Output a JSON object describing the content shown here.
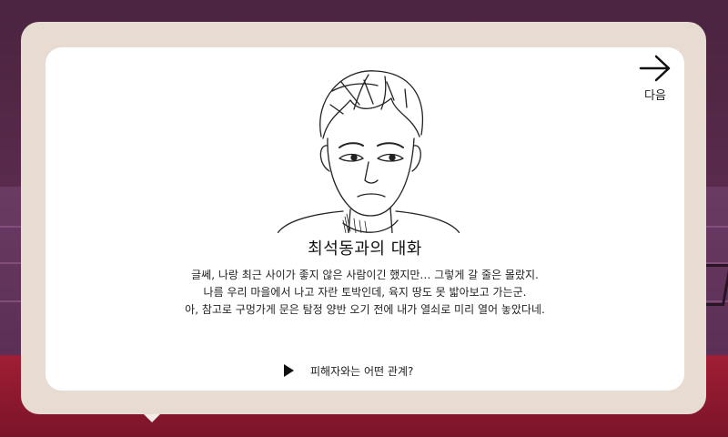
{
  "dialog": {
    "title": "최석동과의 대화",
    "lines": [
      "글쎄, 나랑 최근 사이가 좋지 않은 사람이긴 했지만… 그렇게 갈 줄은 몰랐지.",
      "나름 우리 마을에서 나고 자란 토박인데, 육지 땅도 못 밟아보고 가는군.",
      "아, 참고로 구멍가게 문은 탐정 양반 오기 전에 내가 열쇠로 미리 열어 놓았다네."
    ],
    "choice": {
      "icon": "play-icon",
      "label": "피해자와는 어떤 관계?"
    },
    "next": {
      "icon": "arrow-right-icon",
      "label": "다음"
    },
    "portrait": {
      "icon": "character-portrait"
    }
  },
  "colors": {
    "dialog_outer": "#e7dbd2",
    "dialog_inner": "#ffffff",
    "floor": "#a01e35",
    "wall": "#5a2a4c"
  }
}
